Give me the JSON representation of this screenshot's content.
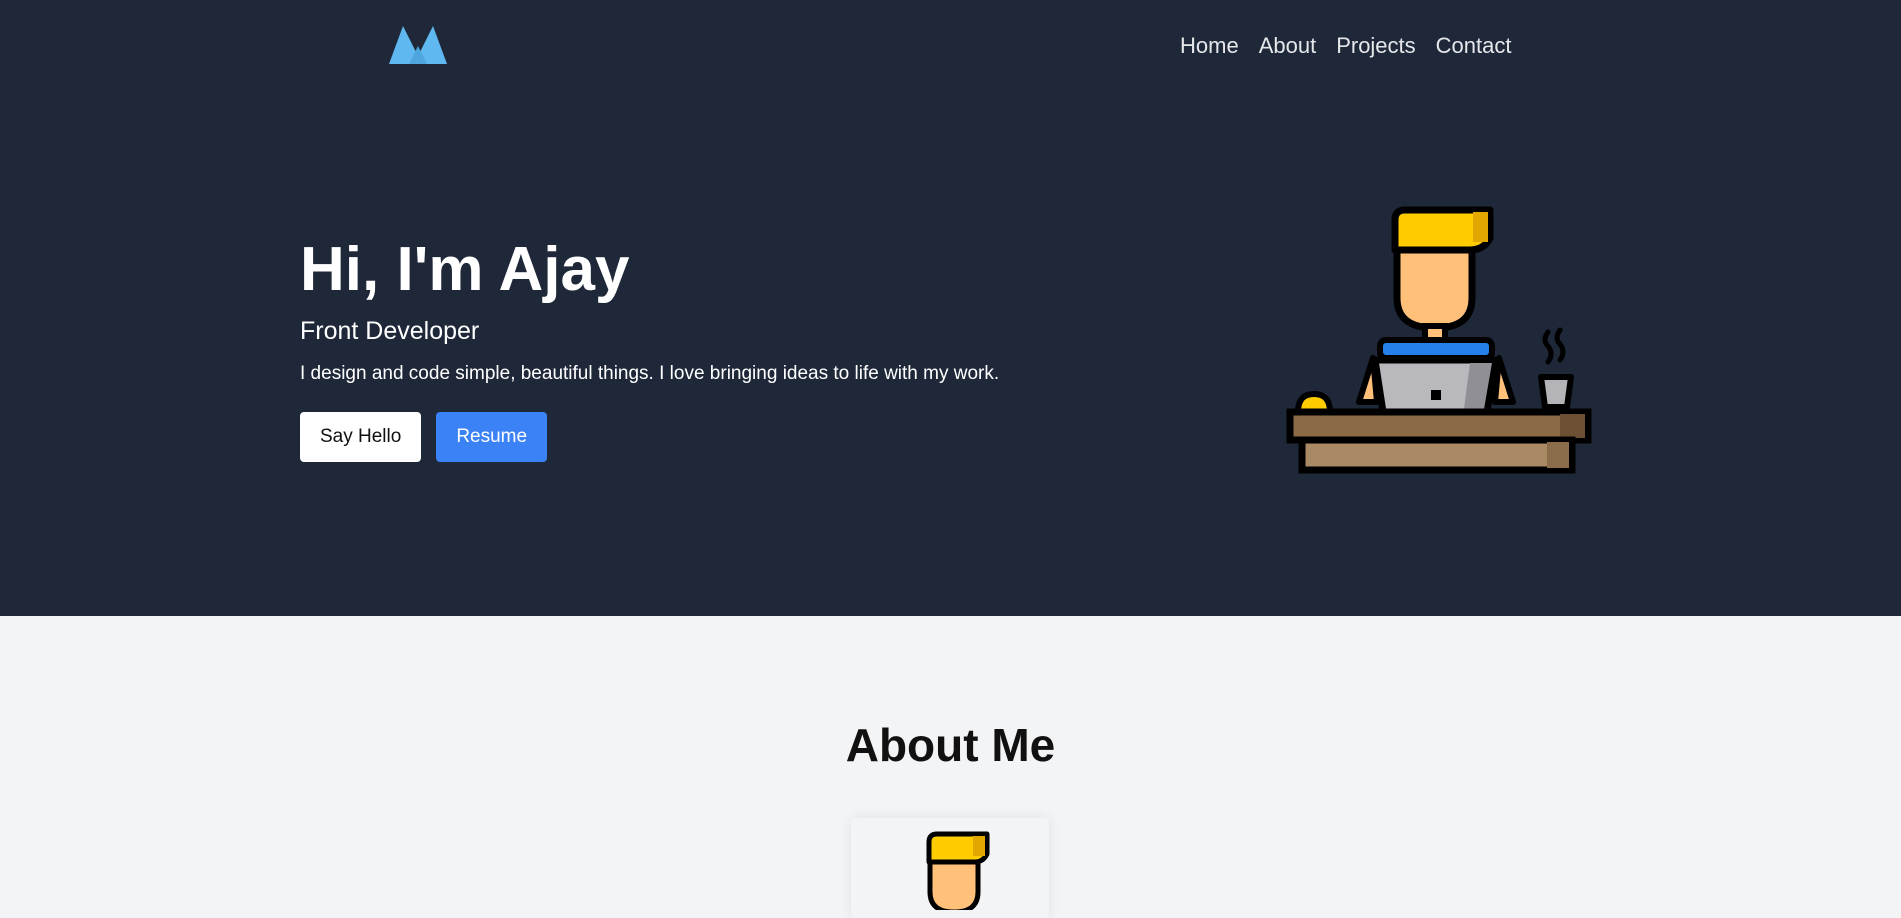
{
  "nav": {
    "items": [
      "Home",
      "About",
      "Projects",
      "Contact"
    ]
  },
  "hero": {
    "title": "Hi, I'm Ajay",
    "subtitle": "Front Developer",
    "description": "I design and code simple, beautiful things. I love bringing ideas to life with my work.",
    "buttons": {
      "primary": "Say Hello",
      "secondary": "Resume"
    }
  },
  "about": {
    "title": "About Me"
  },
  "colors": {
    "hero_bg": "#1f2839",
    "page_bg": "#f3f4f6",
    "accent": "#3b82f6",
    "logo": "#60b8f0"
  },
  "icons": [
    "logo-icon",
    "developer-illustration",
    "avatar-icon"
  ]
}
